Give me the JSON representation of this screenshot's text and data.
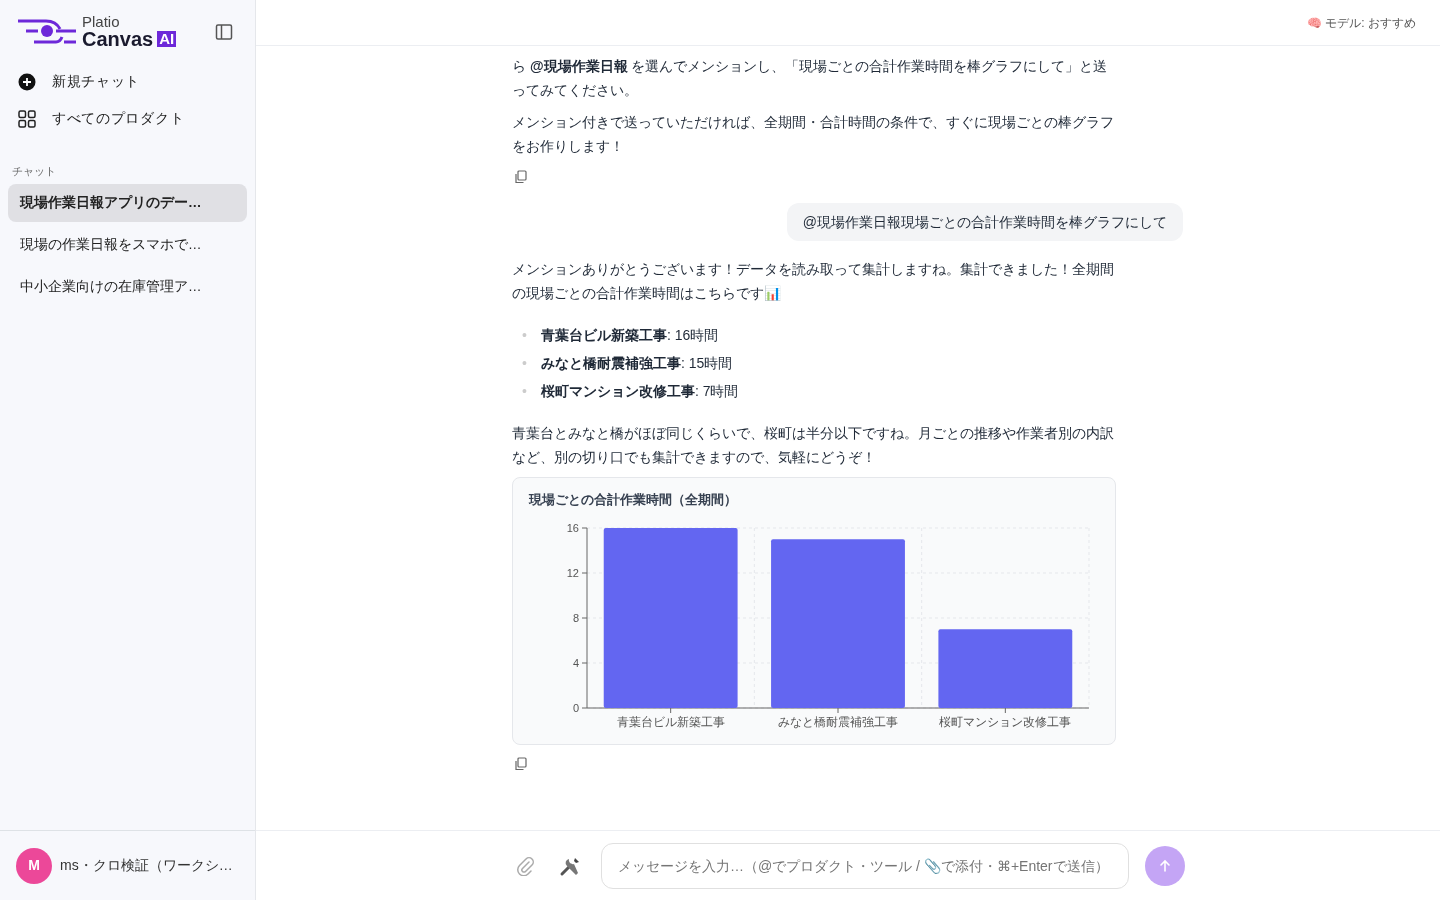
{
  "sidebar": {
    "logo": {
      "top": "Platio",
      "bottom": "Canvas",
      "badge": "AI"
    },
    "actions": [
      {
        "kind": "new",
        "label": "新規チャット"
      },
      {
        "kind": "products",
        "label": "すべてのプロダクト"
      }
    ],
    "section_title": "チャット",
    "chats": [
      {
        "label": "現場作業日報アプリのデー…",
        "selected": true
      },
      {
        "label": "現場の作業日報をスマホで…",
        "selected": false
      },
      {
        "label": "中小企業向けの在庫管理ア…",
        "selected": false
      }
    ],
    "user": {
      "initial": "M",
      "name": "ms・クロ検証（ワークシ…"
    }
  },
  "header": {
    "model": "🧠 モデル: おすすめ"
  },
  "messages": [
    {
      "kind": "assistant",
      "blocks": [
        {
          "kind": "paragraph",
          "text": "ら **@現場作業日報** を選んでメンションし、「現場ごとの合計作業時間を棒グラフにして」と送ってみてください。"
        },
        {
          "kind": "paragraph",
          "text": "メンション付きで送っていただければ、全期間・合計時間の条件で、すぐに現場ごとの棒グラフをお作りします！"
        }
      ]
    },
    {
      "kind": "user",
      "blocks": [
        {
          "kind": "paragraph",
          "text": "@現場作業日報現場ごとの合計作業時間を棒グラフにして"
        }
      ]
    },
    {
      "kind": "assistant",
      "blocks": [
        {
          "kind": "paragraph",
          "text": "メンションありがとうございます！データを読み取って集計しますね。集計できました！全期間の現場ごとの合計作業時間はこちらです📊"
        },
        {
          "kind": "bullets",
          "items": [
            {
              "marker": "•",
              "text": "**青葉台ビル新築工事**: 16時間"
            },
            {
              "marker": "•",
              "text": "**みなと橋耐震補強工事**: 15時間"
            },
            {
              "marker": "•",
              "text": "**桜町マンション改修工事**: 7時間"
            }
          ]
        },
        {
          "kind": "paragraph",
          "text": "青葉台とみなと橋がほぼ同じくらいで、桜町は半分以下ですね。月ごとの推移や作業者別の内訳など、別の切り口でも集計できますので、気軽にどうぞ！"
        },
        {
          "kind": "chart",
          "chart_data": {
            "type": "bar",
            "title": "現場ごとの合計作業時間（全期間）",
            "categories": [
              "青葉台ビル新築工事",
              "みなと橋耐震補強工事",
              "桜町マンション改修工事"
            ],
            "series": [
              {
                "color": "#6366f1",
                "values": [
                  16,
                  15,
                  7
                ]
              }
            ],
            "ylim": [
              0,
              16
            ],
            "yticks": [
              0,
              4,
              8,
              12,
              16
            ],
            "grid": true
          }
        }
      ]
    }
  ],
  "composer": {
    "placeholder": "メッセージを入力…（@でプロダクト・ツール / 📎で添付・⌘+Enterで送信）"
  }
}
